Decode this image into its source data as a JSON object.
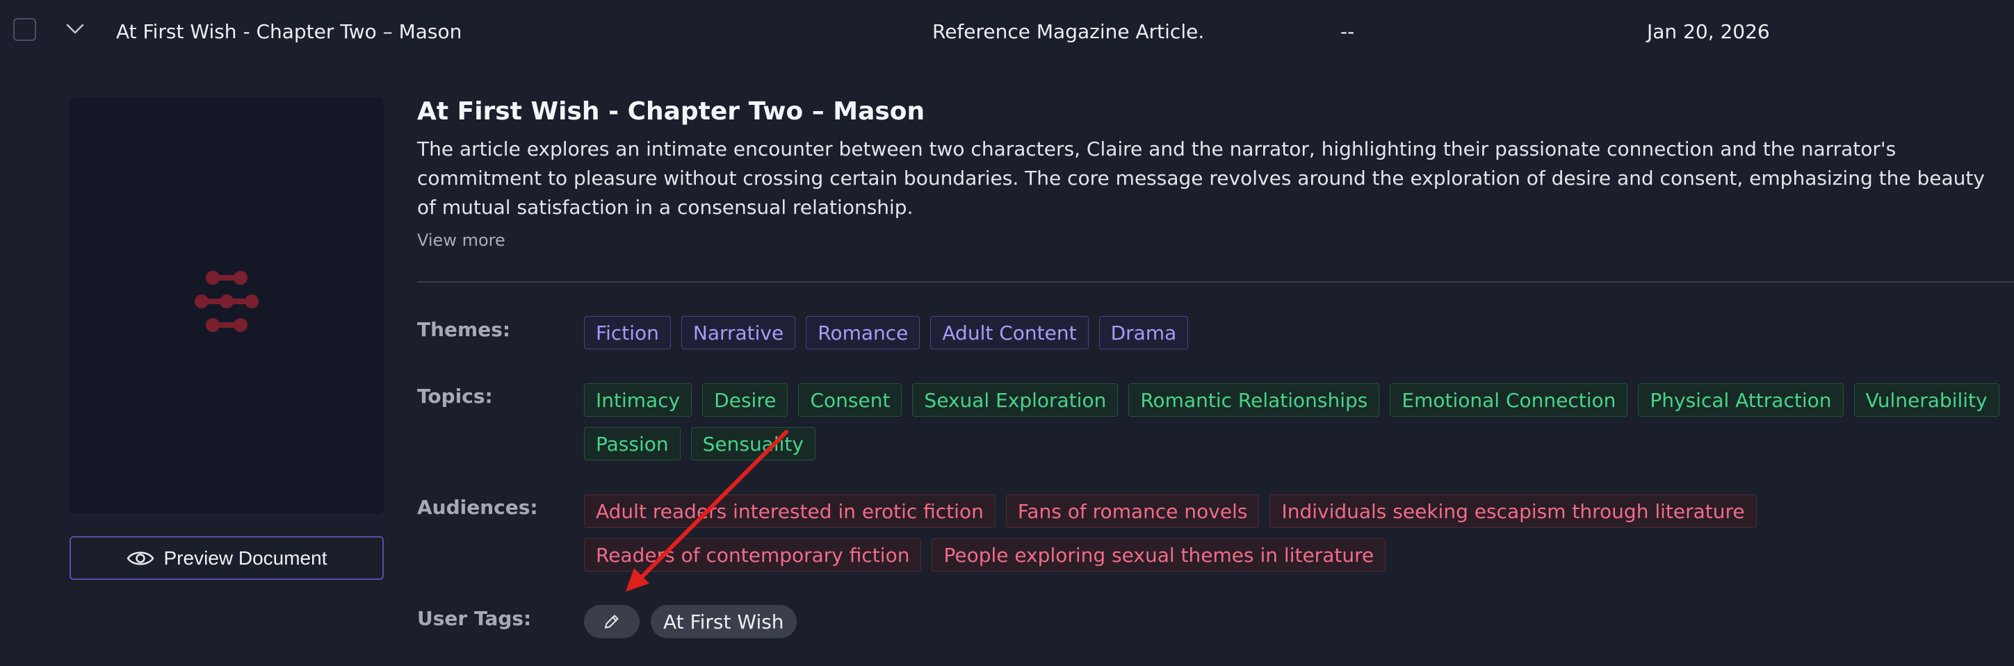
{
  "row": {
    "title": "At First Wish - Chapter Two – Mason",
    "type": "Reference Magazine Article.",
    "extra": "--",
    "date": "Jan 20, 2026"
  },
  "document": {
    "title": "At First Wish - Chapter Two – Mason",
    "description": "The article explores an intimate encounter between two characters, Claire and the narrator, highlighting their passionate connection and the narrator's commitment to pleasure without crossing certain boundaries. The core message revolves around the exploration of desire and consent, emphasizing the beauty of mutual satisfaction in a consensual relationship.",
    "view_more": "View more",
    "preview_label": "Preview Document"
  },
  "labels": {
    "themes": "Themes:",
    "topics": "Topics:",
    "audiences": "Audiences:",
    "user_tags": "User Tags:"
  },
  "themes": [
    "Fiction",
    "Narrative",
    "Romance",
    "Adult Content",
    "Drama"
  ],
  "topics_row1": [
    "Intimacy",
    "Desire",
    "Consent",
    "Sexual Exploration",
    "Romantic Relationships",
    "Emotional Connection",
    "Physical Attraction",
    "Vulnerability"
  ],
  "topics_row2": [
    "Passion",
    "Sensuality"
  ],
  "audiences_row1": [
    "Adult readers interested in erotic fiction",
    "Fans of romance novels",
    "Individuals seeking escapism through literature"
  ],
  "audiences_row2": [
    "Readers of contemporary fiction",
    "People exploring sexual themes in literature"
  ],
  "user_tags": [
    "At First Wish"
  ],
  "colors": {
    "background": "#1b1f2b",
    "theme_tag": "#a79bf6",
    "topic_tag": "#47d48a",
    "audience_tag": "#f26b8a",
    "logo": "#7a1f2e",
    "annotation_arrow": "#e0201c"
  },
  "icons": {
    "row_chevron": "chevron-down-icon",
    "preview": "eye-icon",
    "edit": "pencil-icon",
    "placeholder": "document-logo-icon"
  }
}
